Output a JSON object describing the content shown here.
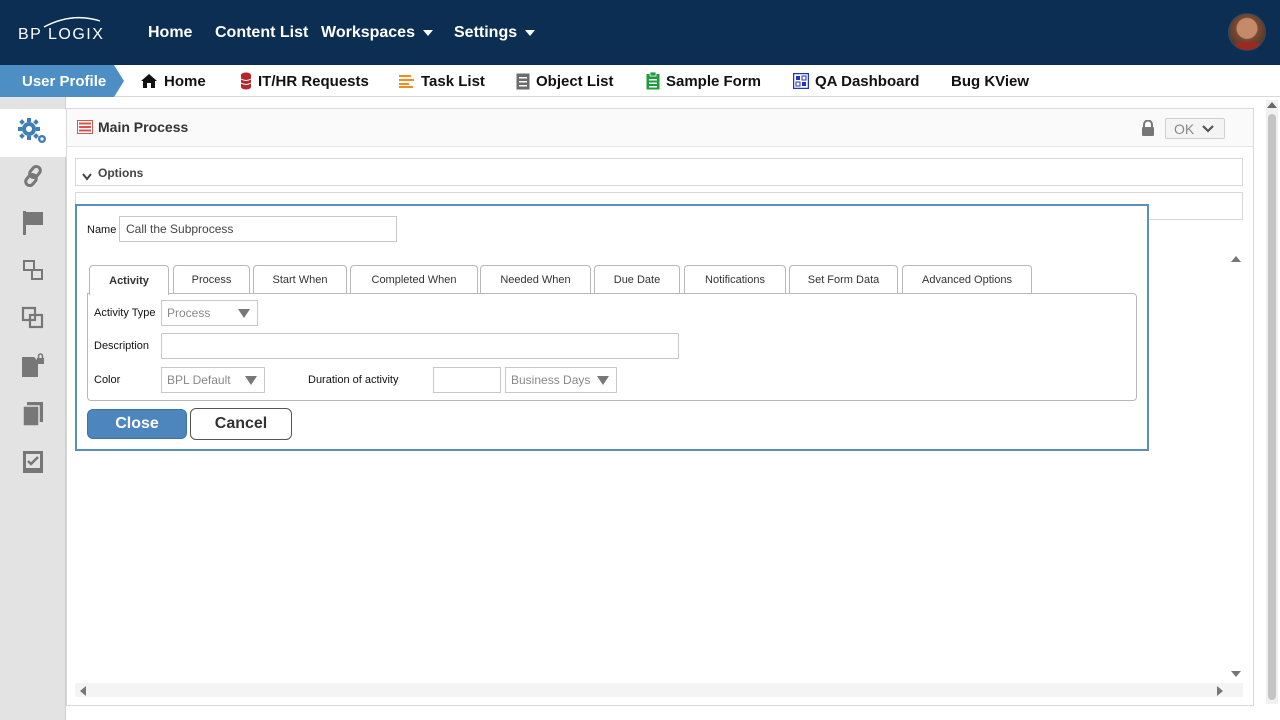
{
  "topbar": {
    "logo": "BP LOGIX",
    "nav": [
      {
        "label": "Home"
      },
      {
        "label": "Content List"
      },
      {
        "label": "Workspaces"
      },
      {
        "label": "Settings"
      }
    ]
  },
  "navbar2": {
    "user_profile": "User Profile",
    "items": [
      {
        "label": "Home",
        "icon": "home-icon"
      },
      {
        "label": "IT/HR Requests",
        "icon": "database-icon"
      },
      {
        "label": "Task List",
        "icon": "list-icon"
      },
      {
        "label": "Object List",
        "icon": "document-icon"
      },
      {
        "label": "Sample Form",
        "icon": "clipboard-icon"
      },
      {
        "label": "QA Dashboard",
        "icon": "dashboard-icon"
      },
      {
        "label": "Bug KView",
        "icon": ""
      }
    ]
  },
  "sidebar": {
    "icons": [
      "gears-icon",
      "link-icon",
      "flag-icon",
      "hierarchy-icon",
      "copy-icon",
      "locked-file-icon",
      "documents-icon",
      "checklist-icon"
    ]
  },
  "panel": {
    "title": "Main Process",
    "ok_label": "OK",
    "sections": [
      {
        "label": "Options"
      }
    ]
  },
  "dialog": {
    "name_label": "Name",
    "name_value": "Call the Subprocess",
    "tabs": [
      "Activity",
      "Process",
      "Start When",
      "Completed When",
      "Needed When",
      "Due Date",
      "Notifications",
      "Set Form Data",
      "Advanced Options"
    ],
    "active_tab": "Activity",
    "activity_type_label": "Activity Type",
    "activity_type_value": "Process",
    "description_label": "Description",
    "description_value": "",
    "color_label": "Color",
    "color_value": "BPL Default",
    "duration_label": "Duration of activity",
    "duration_value": "",
    "duration_unit": "Business Days",
    "close_label": "Close",
    "cancel_label": "Cancel"
  },
  "colors": {
    "topbar": "#0b2e52",
    "accent": "#4d8fc4",
    "dialog_border": "#5a8fbb"
  }
}
